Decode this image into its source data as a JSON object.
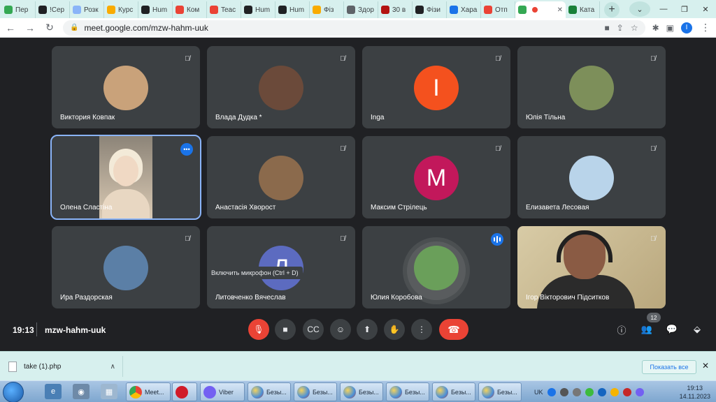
{
  "browser": {
    "tabs": [
      {
        "label": "Пер",
        "color": "#34a853"
      },
      {
        "label": "!Сер",
        "color": "#202124"
      },
      {
        "label": "Розк",
        "color": "#8ab4f8"
      },
      {
        "label": "Курс",
        "color": "#f9ab00"
      },
      {
        "label": "Hum",
        "color": "#202124"
      },
      {
        "label": "Ком",
        "color": "#ea4335"
      },
      {
        "label": "Teac",
        "color": "#ea4335"
      },
      {
        "label": "Hum",
        "color": "#202124"
      },
      {
        "label": "Hum",
        "color": "#202124"
      },
      {
        "label": "Фіз",
        "color": "#f9ab00"
      },
      {
        "label": "Здор",
        "color": "#5f6368"
      },
      {
        "label": "30 в",
        "color": "#b31412"
      },
      {
        "label": "Фізи",
        "color": "#202124"
      },
      {
        "label": "Хара",
        "color": "#1a73e8"
      },
      {
        "label": "Отп",
        "color": "#ea4335"
      },
      {
        "label": "",
        "color": "#34a853",
        "active": true
      },
      {
        "label": "Ката",
        "color": "#188038"
      }
    ],
    "new_tab": "+",
    "url": "meet.google.com/mzw-hahm-uuk",
    "profile_initial": "I"
  },
  "participants": [
    {
      "name": "Виктория Ковпак",
      "muted": true,
      "avatar_color": "#c9a27a"
    },
    {
      "name": "Влада Дудка *",
      "muted": true,
      "avatar_color": "#6b4a3a"
    },
    {
      "name": "Inga",
      "muted": true,
      "initial": "I",
      "avatar_color": "#f4511e"
    },
    {
      "name": "Юлія Тільна",
      "muted": true,
      "avatar_color": "#7d8f5a"
    },
    {
      "name": "Олена Сластіна",
      "video": true
    },
    {
      "name": "Анастасія Хворост",
      "muted": true,
      "avatar_color": "#8b6a4c"
    },
    {
      "name": "Максим Стрілець",
      "muted": true,
      "initial": "M",
      "avatar_color": "#c2185b"
    },
    {
      "name": "Елизавета Лесовая",
      "muted": true,
      "avatar_color": "#b9d4ea"
    },
    {
      "name": "Ира Раздорская",
      "muted": true,
      "avatar_color": "#5b7fa6"
    },
    {
      "name": "Литовченко Вячеслав",
      "muted": true,
      "initial": "Л",
      "avatar_color": "#5c6bc0"
    },
    {
      "name": "Юлия Коробова",
      "speaking": true,
      "avatar_color": "#6a9f5a"
    },
    {
      "name": "Ігор Вікторович Підситков",
      "muted": true,
      "video": true
    }
  ],
  "tooltip": "Включить микрофон (Ctrl + D)",
  "controls": {
    "time": "19:13",
    "meeting_code": "mzw-hahm-uuk",
    "participant_count": "12"
  },
  "downloads": {
    "file": "take (1).php",
    "show_all": "Показать все"
  },
  "taskbar": {
    "meet_label": "Meet...",
    "viber_label": "Viber",
    "paint_label": "Безы...",
    "lang": "UK",
    "time": "19:13",
    "date": "14.11.2023"
  }
}
